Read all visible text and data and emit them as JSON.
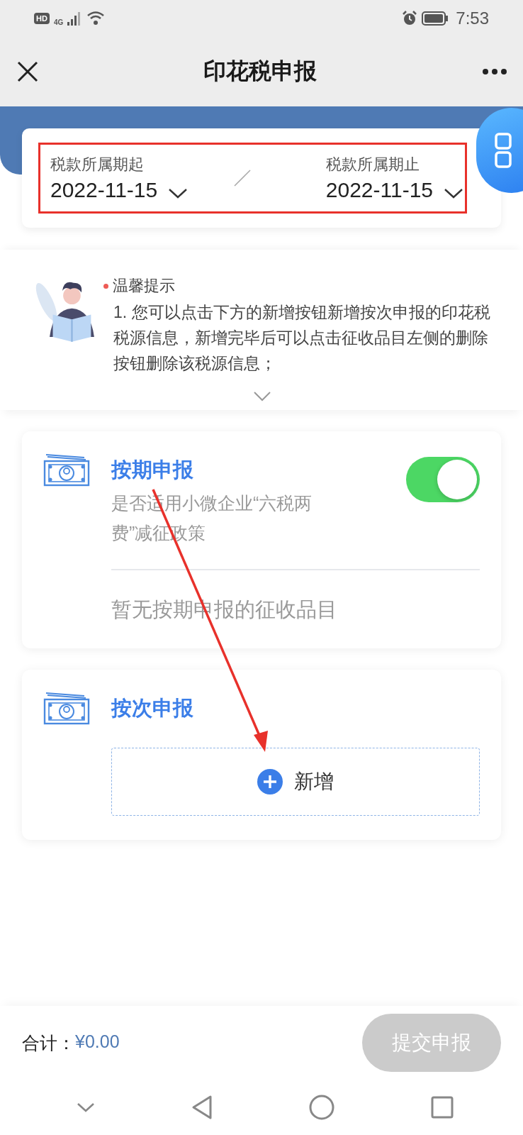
{
  "status_bar": {
    "hd": "HD",
    "network": "4G",
    "time": "7:53"
  },
  "nav_bar": {
    "title": "印花税申报"
  },
  "period": {
    "start_label": "税款所属期起",
    "start_value": "2022-11-15",
    "end_label": "税款所属期止",
    "end_value": "2022-11-15"
  },
  "tip": {
    "title": "温馨提示",
    "text": "1. 您可以点击下方的新增按钮新增按次申报的印花税税源信息，新增完毕后可以点击征收品目左侧的删除按钮删除该税源信息；",
    "expanded": false
  },
  "sections": [
    {
      "kind": "periodic",
      "title": "按期申报",
      "toggle_label": "是否适用小微企业“六税两费”减征政策",
      "toggle_on": true,
      "empty_text": "暂无按期申报的征收品目"
    },
    {
      "kind": "per_time",
      "title": "按次申报",
      "add_label": "新增"
    }
  ],
  "footer": {
    "total_label": "合计：",
    "total_value": "¥0.00",
    "submit": {
      "label": "提交申报",
      "disabled": true
    }
  }
}
